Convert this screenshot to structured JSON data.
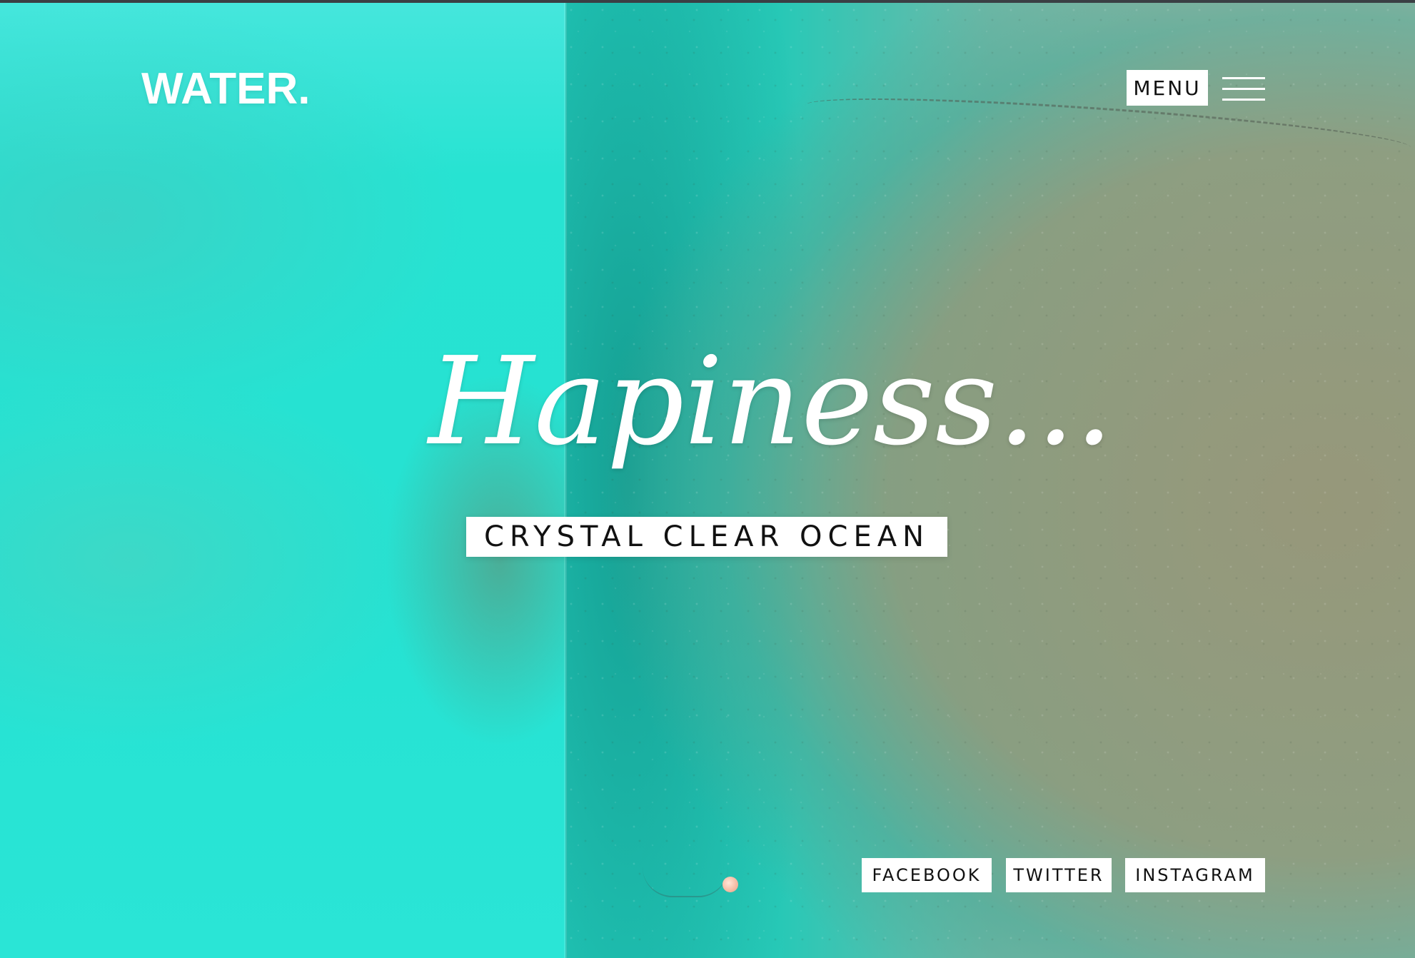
{
  "header": {
    "logo": "WATER.",
    "menu_label": "MENU"
  },
  "hero": {
    "headline": "Hapiness...",
    "subtitle": "CRYSTAL CLEAR OCEAN"
  },
  "social_links": [
    {
      "label": "FACEBOOK"
    },
    {
      "label": "TWITTER"
    },
    {
      "label": "INSTAGRAM"
    }
  ],
  "icons": {
    "menu": "hamburger-icon"
  },
  "colors": {
    "left_panel": "#27e3d2",
    "text": "#ffffff",
    "button_bg": "#ffffff",
    "button_text": "#111111"
  }
}
